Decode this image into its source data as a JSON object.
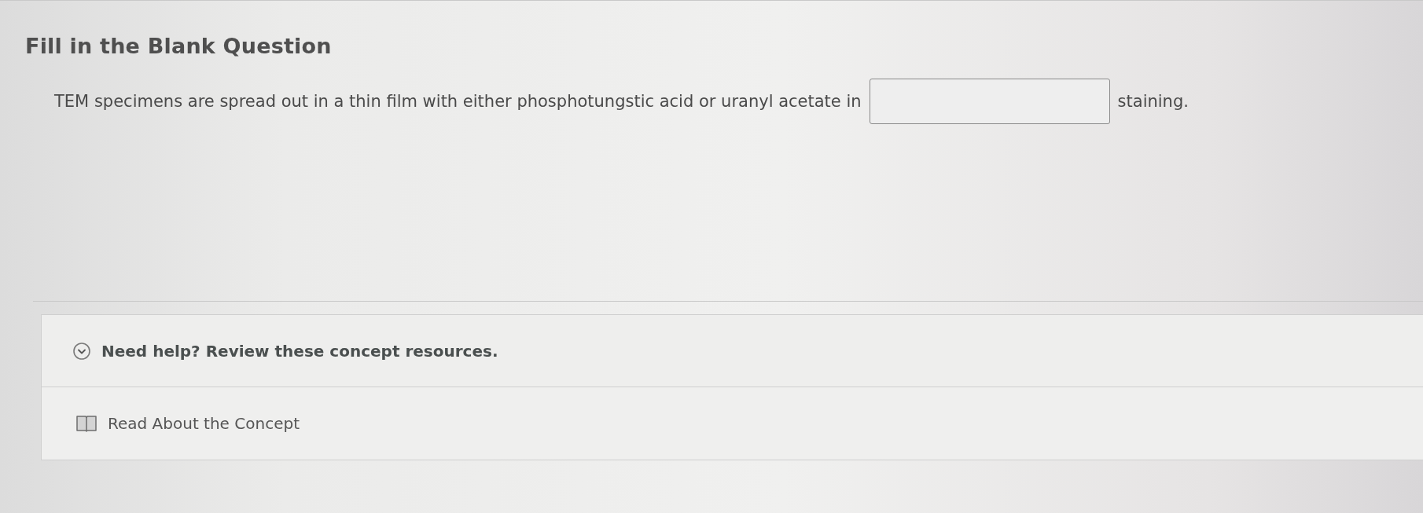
{
  "question": {
    "title": "Fill in the Blank Question",
    "parts": [
      {
        "kind": "text",
        "text": "TEM specimens are spread out in a thin film with either phosphotungstic acid or uranyl acetate in"
      },
      {
        "kind": "blank"
      },
      {
        "kind": "text",
        "text": "staining."
      }
    ]
  },
  "help": {
    "title": "Need help? Review these concept resources.",
    "expanded": true,
    "resources": [
      {
        "kind": "reading",
        "label": "Read About the Concept"
      }
    ]
  }
}
